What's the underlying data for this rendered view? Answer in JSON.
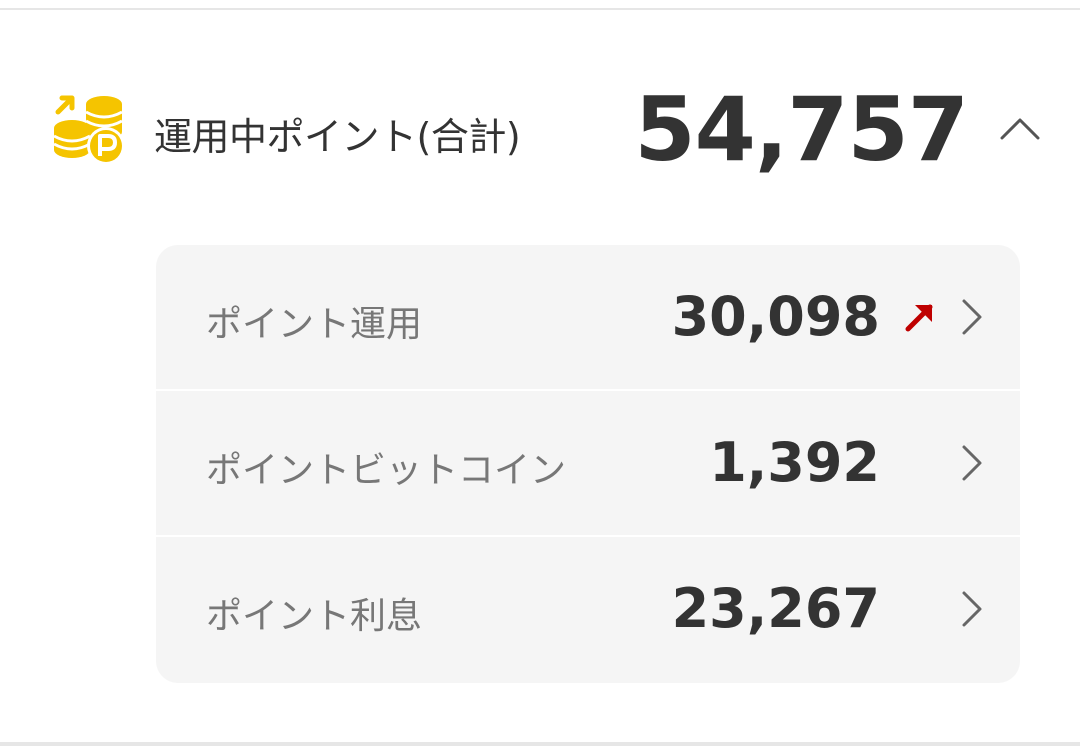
{
  "summary": {
    "title": "運用中ポイント(合計)",
    "total": "54,757",
    "icon": "coins-p-growth-icon",
    "toggle_icon": "chevron-up-icon"
  },
  "details": [
    {
      "label": "ポイント運用",
      "value": "30,098",
      "trend_icon": "arrow-up-right-icon",
      "trend_color": "#bf0000"
    },
    {
      "label": "ポイントビットコイン",
      "value": "1,392"
    },
    {
      "label": "ポイント利息",
      "value": "23,267"
    }
  ],
  "colors": {
    "accent_coin": "#f5c400",
    "text_primary": "#333333",
    "text_secondary": "#777777",
    "card_bg": "#f5f5f5"
  }
}
